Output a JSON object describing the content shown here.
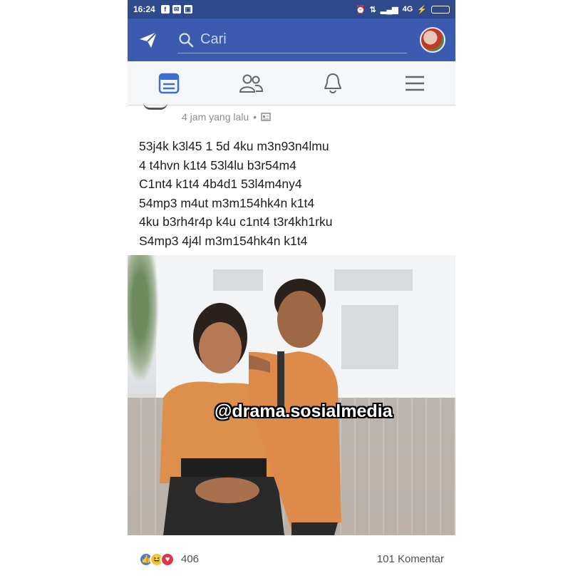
{
  "status_bar": {
    "time": "16:24",
    "network": "4G"
  },
  "app_bar": {
    "search_placeholder": "Cari"
  },
  "tabs": [
    {
      "name": "news-feed",
      "icon": "feed-icon",
      "active": true
    },
    {
      "name": "friends",
      "icon": "friends-icon",
      "active": false
    },
    {
      "name": "notifications",
      "icon": "bell-icon",
      "active": false
    },
    {
      "name": "menu",
      "icon": "hamburger-menu-icon",
      "active": false
    }
  ],
  "post": {
    "timestamp": "4 jam yang lalu",
    "separator": "•",
    "lines": [
      "53j4k k3l45 1 5d 4ku m3n93n4lmu",
      "4 t4hvn k1t4 53l4lu b3r54m4",
      "C1nt4 k1t4 4b4d1 53l4m4ny4",
      "54mp3 m4ut m3m154hk4n k1t4",
      "4ku b3rh4r4p k4u c1nt4 t3r4kh1rku",
      "S4mp3 4j4l m3m154hk4n k1t4"
    ],
    "watermark": "@drama.sosialmedia",
    "reactions": {
      "count": "406",
      "types": [
        "like",
        "haha",
        "love"
      ]
    },
    "comments_label": "101 Komentar"
  },
  "colors": {
    "status_bar": "#2e4a8c",
    "app_bar": "#3b5bb0",
    "active_tab": "#3b6fd4",
    "inactive_tab": "#606770"
  }
}
